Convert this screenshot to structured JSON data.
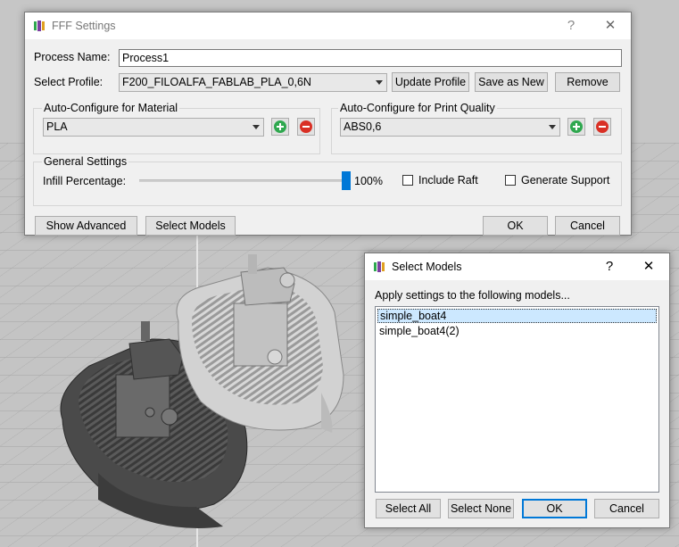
{
  "fff_settings": {
    "title": "FFF Settings",
    "help_glyph": "?",
    "close_glyph": "✕",
    "process_name_label": "Process Name:",
    "process_name_value": "Process1",
    "select_profile_label": "Select Profile:",
    "profile_selected": "F200_FILOALFA_FABLAB_PLA_0,6N",
    "update_profile_label": "Update Profile",
    "save_as_new_label": "Save as New",
    "remove_label": "Remove",
    "material_group_title": "Auto-Configure for Material",
    "material_selected": "PLA",
    "quality_group_title": "Auto-Configure for Print Quality",
    "quality_selected": "ABS0,6",
    "general_group_title": "General Settings",
    "infill_label": "Infill Percentage:",
    "infill_percent": 100,
    "infill_text": "100%",
    "include_raft_label": "Include Raft",
    "include_raft_checked": false,
    "generate_support_label": "Generate Support",
    "generate_support_checked": false,
    "show_advanced_label": "Show Advanced",
    "select_models_label": "Select Models",
    "ok_label": "OK",
    "cancel_label": "Cancel"
  },
  "select_models": {
    "title": "Select Models",
    "help_glyph": "?",
    "close_glyph": "✕",
    "instruction": "Apply settings to the following models...",
    "models": [
      {
        "name": "simple_boat4",
        "selected": true
      },
      {
        "name": "simple_boat4(2)",
        "selected": false
      }
    ],
    "select_all_label": "Select All",
    "select_none_label": "Select None",
    "ok_label": "OK",
    "cancel_label": "Cancel"
  },
  "colors": {
    "accent": "#0078d7",
    "add": "#2fa84f",
    "remove": "#d93025",
    "viewport_bg": "#bdbdbd"
  }
}
